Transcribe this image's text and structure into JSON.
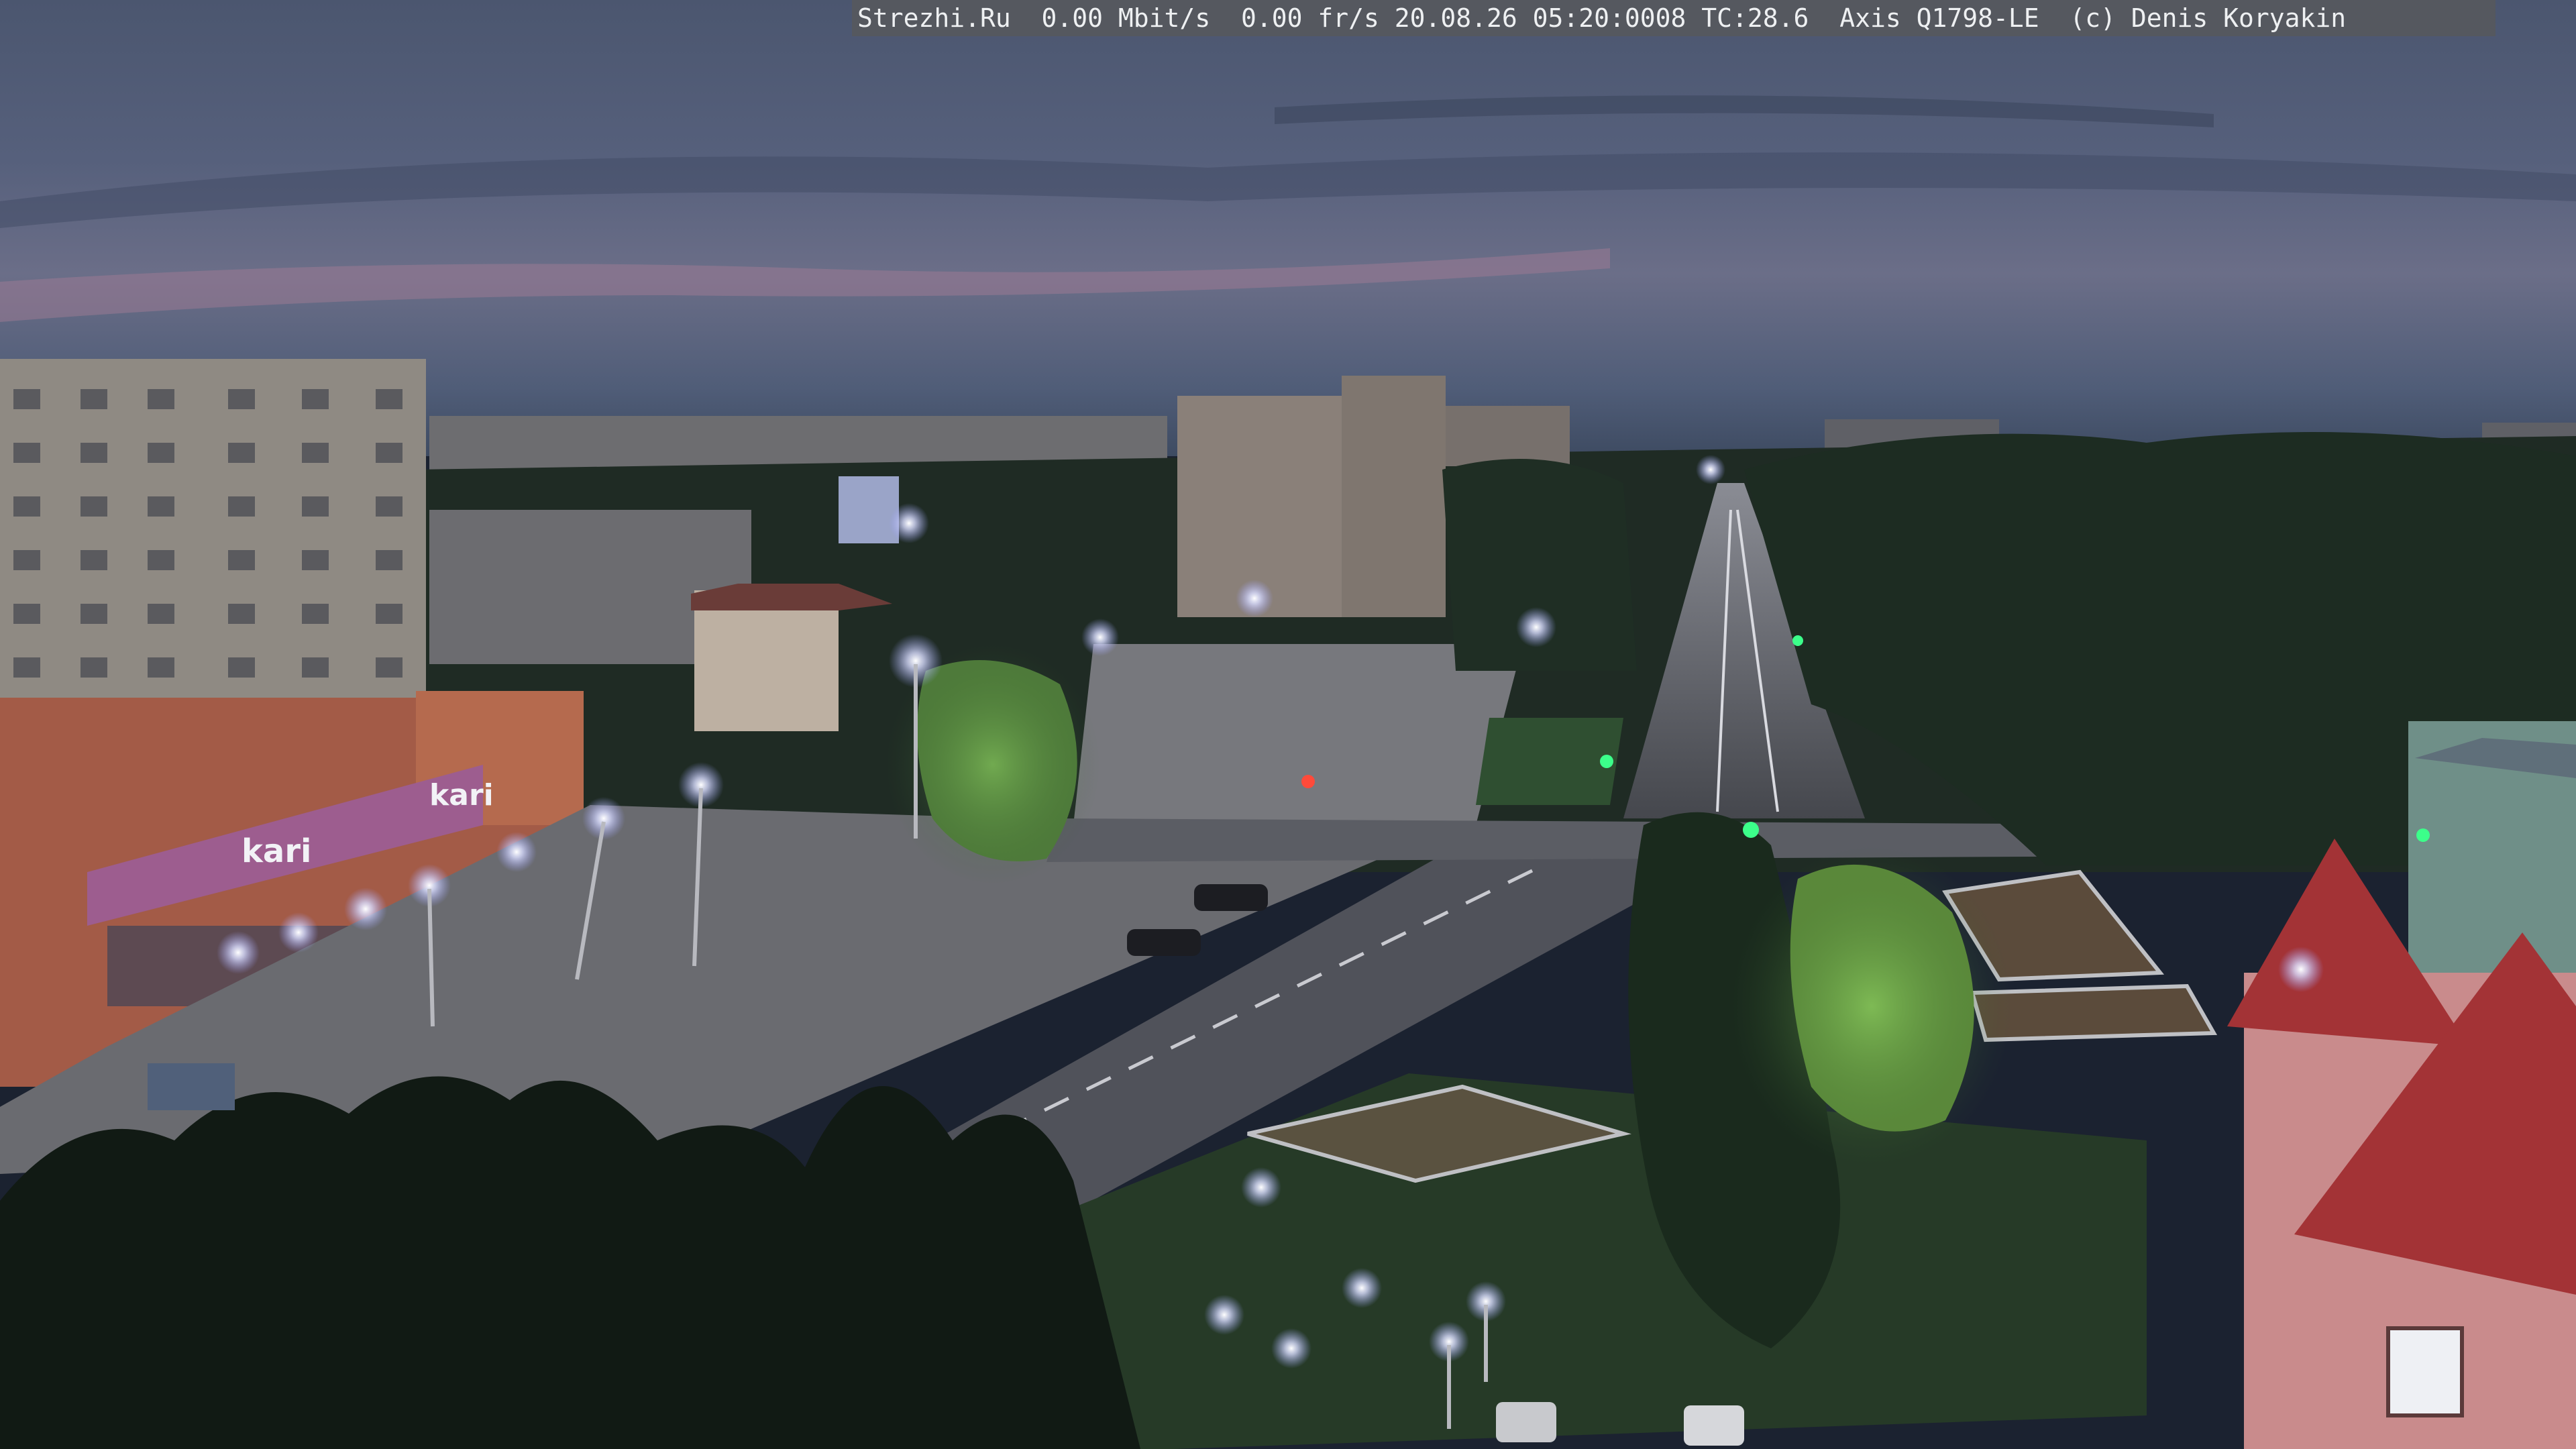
{
  "camera_overlay": {
    "text": "Strezhi.Ru  0.00 Mbit/s  0.00 fr/s 20.08.26 05:20:0008 TC:28.6  Axis Q1798-LE  (c) Denis Koryakin"
  },
  "signage": {
    "store_sign": "kari",
    "store_sign_large": "kari"
  },
  "colors": {
    "sky_top": "#4a5670",
    "sky_mid": "#6a6f8a",
    "sky_horizon": "#8a7a96",
    "pink_cloud": "#b07a8c",
    "street_light": "#e8eaff",
    "trees": "#1c2a20",
    "road": "#4d5058",
    "square": "#6a6b70"
  }
}
